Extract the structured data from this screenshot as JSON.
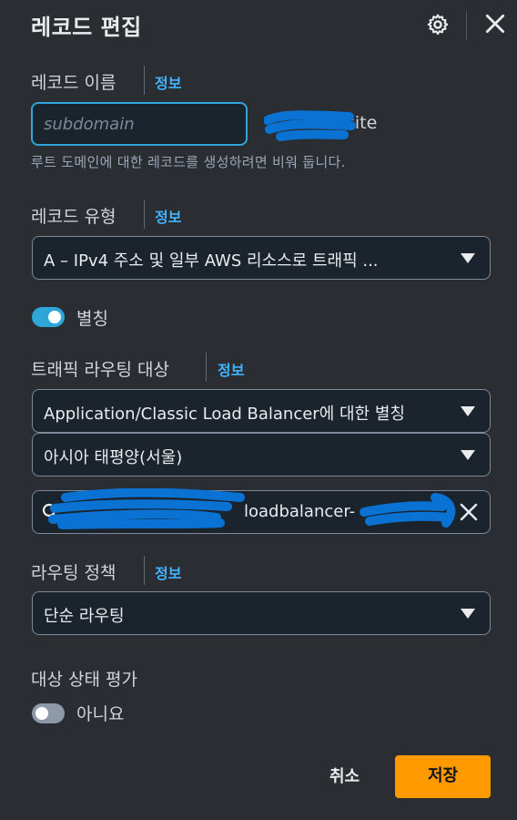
{
  "panel": {
    "title": "레코드 편집",
    "info_link": "정보"
  },
  "record_name": {
    "label": "레코드 이름",
    "placeholder": "subdomain",
    "domain_suffix": "site",
    "hint": "루트 도메인에 대한 레코드를 생성하려면 비워 둡니다."
  },
  "record_type": {
    "label": "레코드 유형",
    "selected": "A – IPv4 주소 및 일부 AWS 리소스로 트래픽 ..."
  },
  "alias": {
    "label": "별칭",
    "enabled": true
  },
  "route_target": {
    "label": "트래픽 라우팅 대상",
    "endpoint_type": "Application/Classic Load Balancer에 대한 별칭",
    "region": "아시아 태평양(서울)",
    "load_balancer_partial": "loadbalancer-"
  },
  "routing_policy": {
    "label": "라우팅 정책",
    "selected": "단순 라우팅"
  },
  "health_check": {
    "label": "대상 상태 평가",
    "enabled": false,
    "state_label": "아니요"
  },
  "actions": {
    "cancel": "취소",
    "save": "저장"
  },
  "icons": {
    "settings": "gear-icon",
    "close": "close-icon",
    "dropdown": "caret-down-icon",
    "search": "search-icon",
    "clear": "clear-icon"
  },
  "colors": {
    "background": "#2a2e33",
    "field_bg": "#1b232d",
    "accent": "#2ea7d8",
    "link": "#42b4ff",
    "primary_button": "#ff9900",
    "redaction": "#0972d3"
  }
}
